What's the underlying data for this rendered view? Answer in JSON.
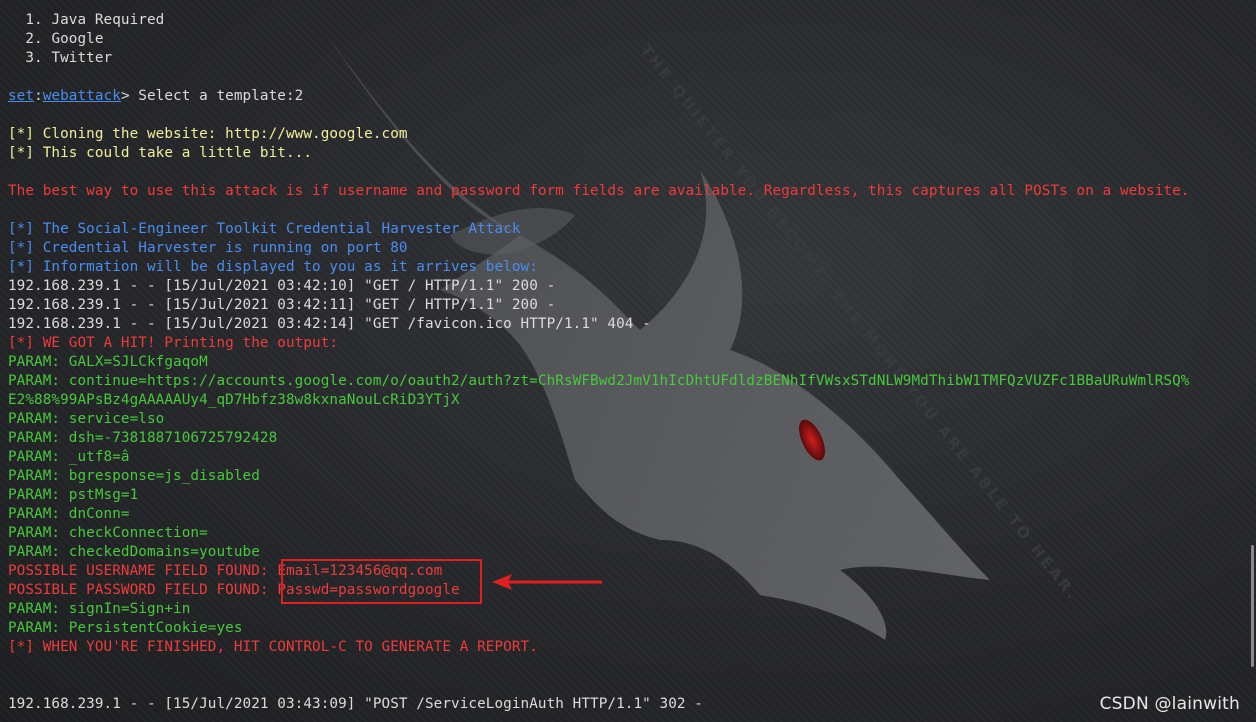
{
  "menu": [
    {
      "number": "1.",
      "label": "Java Required"
    },
    {
      "number": "2.",
      "label": "Google"
    },
    {
      "number": "3.",
      "label": "Twitter"
    }
  ],
  "prompt": {
    "module": "set",
    "separator": ":",
    "submodule": "webattack",
    "suffix": "> Select a template:2"
  },
  "status": {
    "marker": "[*]",
    "cloning": " Cloning the website: http://www.google.com",
    "wait": " This could take a little bit..."
  },
  "warning": "The best way to use this attack is if username and password form fields are available. Regardless, this captures all POSTs on a website.",
  "harvester": {
    "title": " The Social-Engineer Toolkit Credential Harvester Attack",
    "port_msg": " Credential Harvester is running on port 80",
    "info_msg": " Information will be displayed to you as it arrives below:"
  },
  "requests": [
    "192.168.239.1 - - [15/Jul/2021 03:42:10] \"GET / HTTP/1.1\" 200 -",
    "192.168.239.1 - - [15/Jul/2021 03:42:11] \"GET / HTTP/1.1\" 200 -",
    "192.168.239.1 - - [15/Jul/2021 03:42:14] \"GET /favicon.ico HTTP/1.1\" 404 -"
  ],
  "hit_msg": " WE GOT A HIT! Printing the output:",
  "params_a": [
    "PARAM: GALX=SJLCkfgaqoM",
    "PARAM: continue=https://accounts.google.com/o/oauth2/auth?zt=ChRsWFBwd2JmV1hIcDhtUFdldzBENhIfVWsxSTdNLW9MdThibW1TMFQzVUZFc1BBaURuWmlRSQ%",
    "E2%88%99APsBz4gAAAAAUy4_qD7Hbfz38w8kxnaNouLcRiD3YTjX",
    "PARAM: service=lso",
    "PARAM: dsh=-7381887106725792428",
    "PARAM: _utf8=â",
    "PARAM: bgresponse=js_disabled",
    "PARAM: pstMsg=1",
    "PARAM: dnConn=",
    "PARAM: checkConnection=",
    "PARAM: checkedDomains=youtube"
  ],
  "found": [
    {
      "label": "POSSIBLE USERNAME FIELD FOUND: ",
      "value": "Email=123456@qq.com"
    },
    {
      "label": "POSSIBLE PASSWORD FIELD FOUND: ",
      "value": "Passwd=passwordgoogle"
    }
  ],
  "params_b": [
    "PARAM: signIn=Sign+in",
    "PARAM: PersistentCookie=yes"
  ],
  "finish_msg": " WHEN YOU'RE FINISHED, HIT CONTROL-C TO GENERATE A REPORT.",
  "post_request": "192.168.239.1 - - [15/Jul/2021 03:43:09] \"POST /ServiceLoginAuth HTTP/1.1\" 302 -",
  "watermark": "CSDN @lainwith",
  "background_text": "THE QUIETER YOU BECOME, THE MORE YOU ARE ABLE TO HEAR.",
  "colors": {
    "text": "#dcdcdc",
    "yellow": "#f2ef9a",
    "red": "#ee3b3b",
    "blue": "#4a8df0",
    "green": "#47c93b",
    "highlight": "#e02020"
  }
}
